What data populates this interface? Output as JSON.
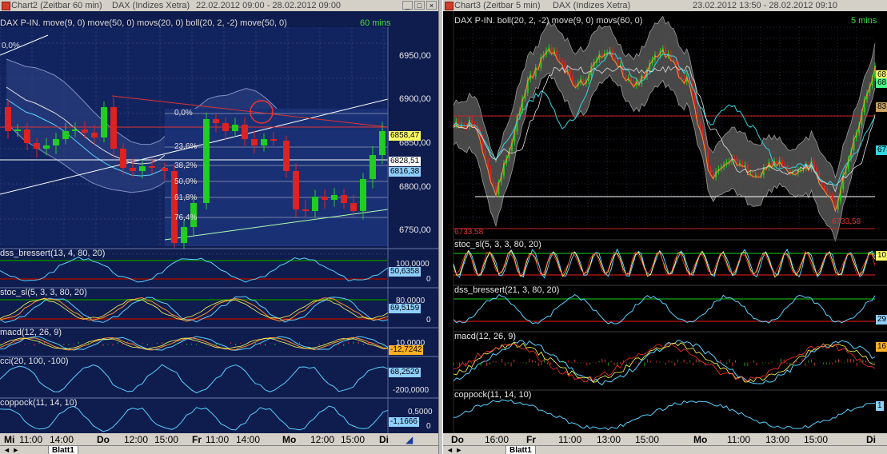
{
  "window1": {
    "title": "Chart2 (Zeitbar 60 min)",
    "instrument": "DAX (Indizes Xetra)",
    "range": "22.02.2012 09:00 - 28.02.2012 09:00",
    "timeframe": "60 mins",
    "main_label": "DAX P-IN.  move(9, 0) move(50, 0) movs(20, 0) boll(20, 2, -2) move(50, 0)",
    "price_axis": [
      "6950,00",
      "6900,00",
      "6850,00",
      "6800,00",
      "6750,00"
    ],
    "price_tags": [
      {
        "value": "6858,47",
        "color": "#ffff66",
        "text_color": "#000"
      },
      {
        "value": "6828,51",
        "color": "#ffffff",
        "text_color": "#000"
      },
      {
        "value": "6816,38",
        "color": "#8fd0ff",
        "text_color": "#000"
      }
    ],
    "fib_levels": [
      "0,0%",
      "0,0%",
      "23,6%",
      "38,2%",
      "50,0%",
      "61,8%",
      "76,4%"
    ],
    "indicators": [
      {
        "label": "dss_bressert(13, 4, 80, 20)",
        "axis_top": "100,0000",
        "axis_bottom": "0",
        "tag": "50,6358"
      },
      {
        "label": "stoc_sl(5, 3, 3, 80, 20)",
        "axis_top": "80,0000",
        "axis_bottom": "0",
        "tag": "69,5159"
      },
      {
        "label": "macd(12, 26, 9)",
        "axis_top": "10,0000",
        "axis_bottom": "",
        "tag": "-12,7242"
      },
      {
        "label": "cci(20, 100, -100)",
        "axis_top": "",
        "axis_bottom": "-200,0000",
        "tag": "68,2529"
      },
      {
        "label": "coppock(11, 14, 10)",
        "axis_top": "0,5000",
        "axis_bottom": "0",
        "tag": "-1,1666"
      }
    ],
    "time_axis": [
      "Mi",
      "11:00",
      "14:00",
      "Do",
      "12:00",
      "15:00",
      "Fr",
      "11:00",
      "14:00",
      "Mo",
      "12:00",
      "15:00",
      "Di"
    ],
    "tab": "Blatt1"
  },
  "window2": {
    "title": "Chart3 (Zeitbar 5 min)",
    "instrument": "DAX (Indizes Xetra)",
    "range": "23.02.2012 13:50 - 28.02.2012 09:10",
    "timeframe": "5 mins",
    "main_label": "DAX P-IN.  boll(20, 2, -2) move(9, 0) movs(60, 0)",
    "low_label": "6733,58",
    "low_label_right": "6733,58",
    "right_tags": [
      "68",
      "68",
      "83",
      "67"
    ],
    "indicators": [
      {
        "label": "stoc_sl(5, 3, 3, 80, 20)",
        "tag": "10"
      },
      {
        "label": "dss_bressert(21, 3, 80, 20)",
        "tag": "29"
      },
      {
        "label": "macd(12, 26, 9)",
        "tag": "16"
      },
      {
        "label": "coppock(11, 14, 10)",
        "tag": "1"
      }
    ],
    "time_axis": [
      "Do",
      "16:00",
      "Fr",
      "11:00",
      "13:00",
      "15:00",
      "Mo",
      "11:00",
      "13:00",
      "15:00",
      "Di"
    ],
    "tab": "Blatt1"
  },
  "colors": {
    "bg_left": "#0e1c4e",
    "bg_right": "#000000",
    "candle_up": "#22cc22",
    "candle_down": "#dd2222",
    "grid": "#2a3a6a",
    "overbought": "#7a1010",
    "oversold": "#0c6a0c"
  },
  "icons": {
    "window_min": "minimize-icon",
    "window_max": "maximize-icon",
    "window_close": "close-icon"
  }
}
